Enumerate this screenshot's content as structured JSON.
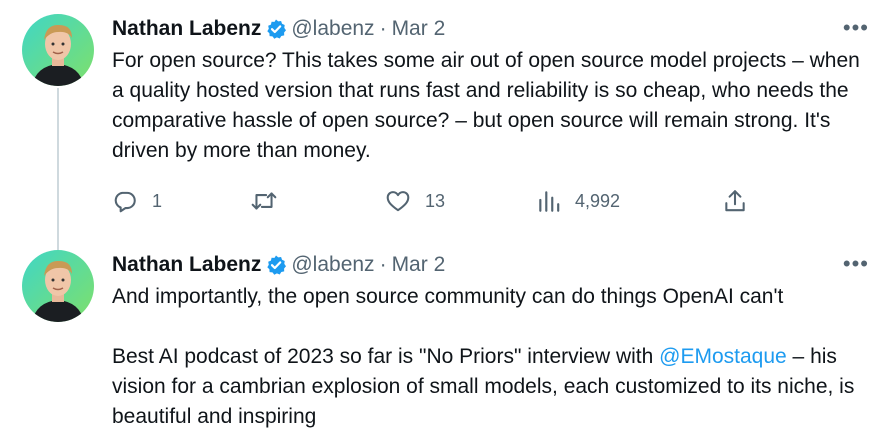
{
  "colors": {
    "text": "#0f1419",
    "secondary": "#536471",
    "link": "#1d9bf0",
    "verified": "#1d9bf0",
    "thread_line": "#cfd9de"
  },
  "tweets": [
    {
      "author_name": "Nathan Labenz",
      "handle": "@labenz",
      "separator": "·",
      "date": "Mar 2",
      "more": "•••",
      "paragraphs": [
        "For open source?  This takes some air out of open source model projects – when a quality hosted version that runs fast and reliability is so cheap, who needs the comparative hassle of open source? – but open source will remain strong.  It's driven by more than money."
      ],
      "actions": {
        "reply_count": "1",
        "retweet_count": "",
        "like_count": "13",
        "view_count": "4,992"
      }
    },
    {
      "author_name": "Nathan Labenz",
      "handle": "@labenz",
      "separator": "·",
      "date": "Mar 2",
      "more": "•••",
      "paragraph_1": "And importantly, the open source community can do things OpenAI can't",
      "paragraph_2_before": "Best AI podcast of 2023 so far is \"No Priors\" interview with ",
      "paragraph_2_mention": "@EMostaque",
      "paragraph_2_after": " – his vision for a cambrian explosion of small models, each customized to its niche, is beautiful and inspiring"
    }
  ]
}
